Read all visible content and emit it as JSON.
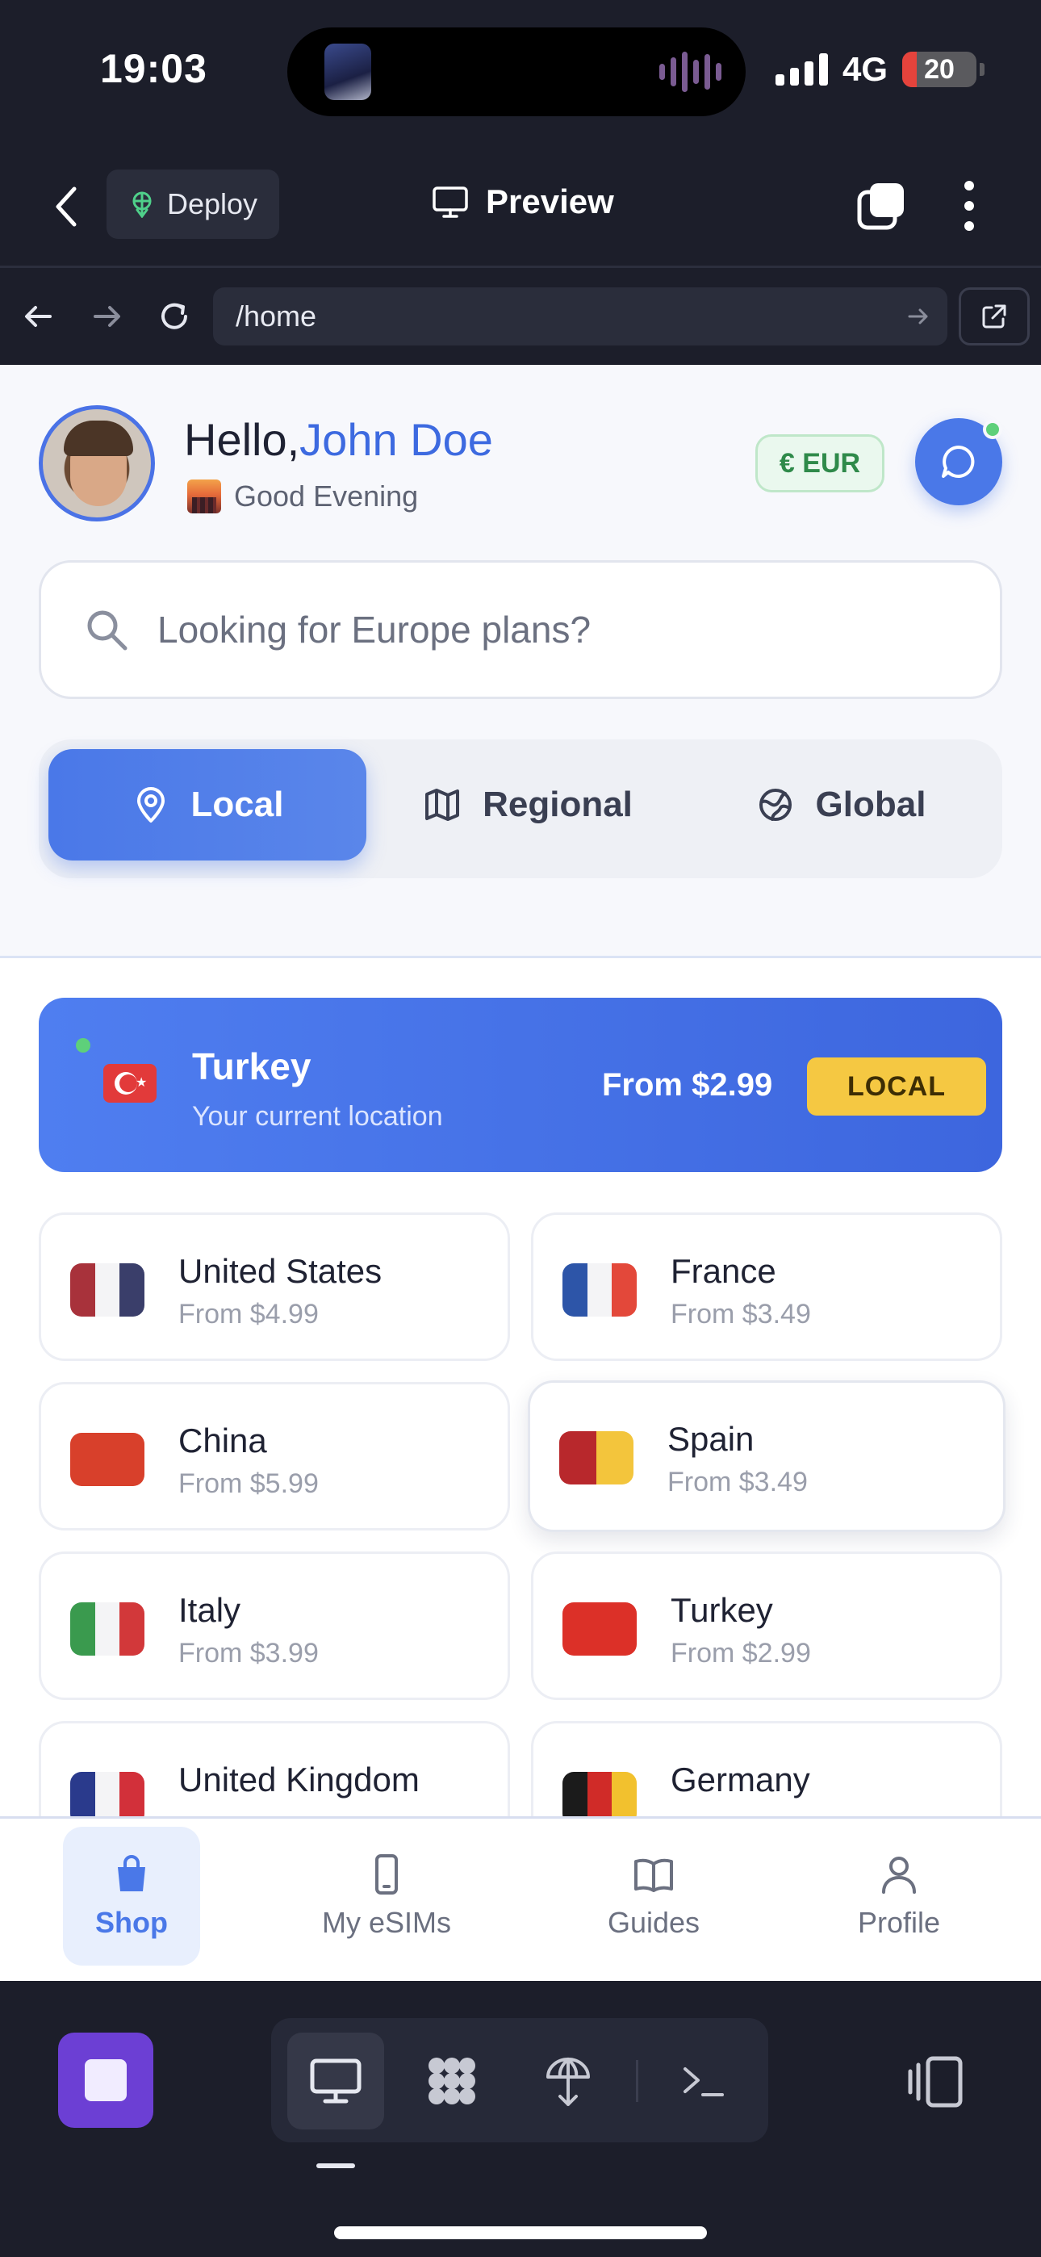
{
  "status_bar": {
    "time": "19:03",
    "network": "4G",
    "battery": "20",
    "battery_fraction": 0.2,
    "icons": [
      "signal-icon",
      "battery-icon",
      "audio-wave-icon"
    ]
  },
  "ide_header": {
    "deploy_label": "Deploy",
    "title": "Preview"
  },
  "browser": {
    "url": "/home"
  },
  "app": {
    "greeting_prefix": "Hello,",
    "user_name": "John Doe",
    "subgreeting": "Good Evening",
    "currency": "€ EUR",
    "search_placeholder": "Looking for Europe plans?",
    "segments": [
      {
        "label": "Local",
        "icon": "map-pin-icon",
        "active": true
      },
      {
        "label": "Regional",
        "icon": "map-icon",
        "active": false
      },
      {
        "label": "Global",
        "icon": "globe-icon",
        "active": false
      }
    ],
    "current_location": {
      "name": "Turkey",
      "subtitle": "Your current location",
      "price": "From $2.99",
      "badge": "LOCAL"
    },
    "countries": [
      {
        "name": "United States",
        "price": "From $4.99"
      },
      {
        "name": "France",
        "price": "From $3.49"
      },
      {
        "name": "China",
        "price": "From $5.99"
      },
      {
        "name": "Spain",
        "price": "From $3.49"
      },
      {
        "name": "Italy",
        "price": "From $3.99"
      },
      {
        "name": "Turkey",
        "price": "From $2.99"
      },
      {
        "name": "United Kingdom",
        "price": ""
      },
      {
        "name": "Germany",
        "price": ""
      }
    ],
    "tabs": [
      {
        "label": "Shop",
        "icon": "shopping-bag-icon",
        "active": true
      },
      {
        "label": "My eSIMs",
        "icon": "phone-icon",
        "active": false
      },
      {
        "label": "Guides",
        "icon": "book-icon",
        "active": false
      },
      {
        "label": "Profile",
        "icon": "user-icon",
        "active": false
      }
    ]
  },
  "colors": {
    "accent": "#4a78e8",
    "ide_background": "#1c1e2a",
    "badge_yellow": "#f5c842",
    "currency_green": "#2f8a4a",
    "stop_purple": "#6c3fd4"
  }
}
